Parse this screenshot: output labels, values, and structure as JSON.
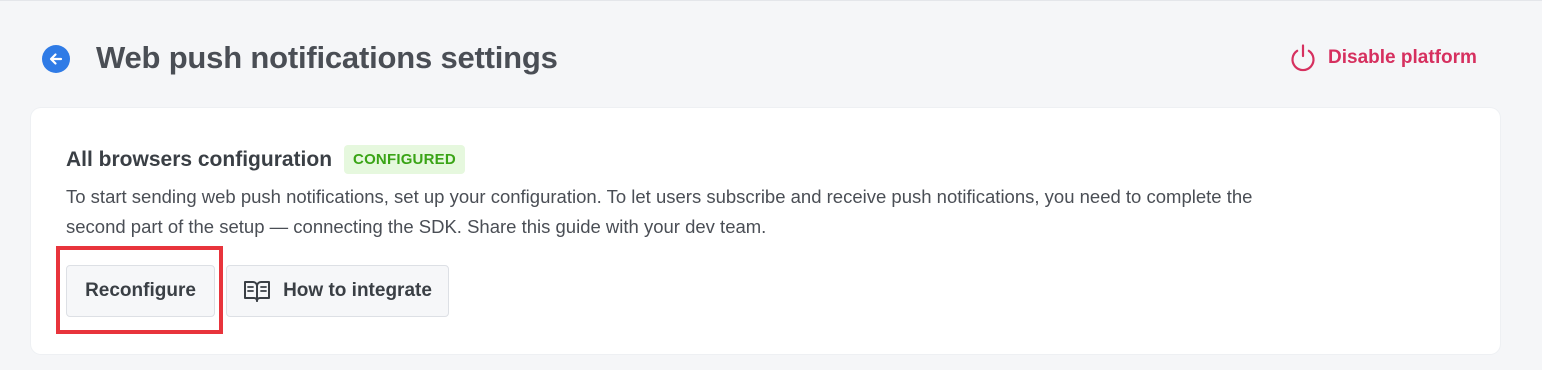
{
  "header": {
    "title": "Web push notifications settings",
    "back_icon": "arrow-left-icon",
    "disable_label": "Disable platform",
    "disable_icon": "power-icon"
  },
  "card": {
    "title": "All browsers configuration",
    "badge": "CONFIGURED",
    "description_line1": "To start sending web push notifications, set up your configuration. To let users subscribe and receive push notifications, you need to  complete the",
    "description_line2": "second part of the setup — connecting the SDK. Share this guide with your dev team.",
    "reconfigure_label": "Reconfigure",
    "integrate_label": "How to integrate",
    "integrate_icon": "book-open-icon"
  },
  "colors": {
    "accent_blue": "#2f7be6",
    "danger": "#d6305f",
    "badge_bg": "#e6f8de",
    "badge_text": "#3aa416",
    "highlight": "#e8343c"
  }
}
